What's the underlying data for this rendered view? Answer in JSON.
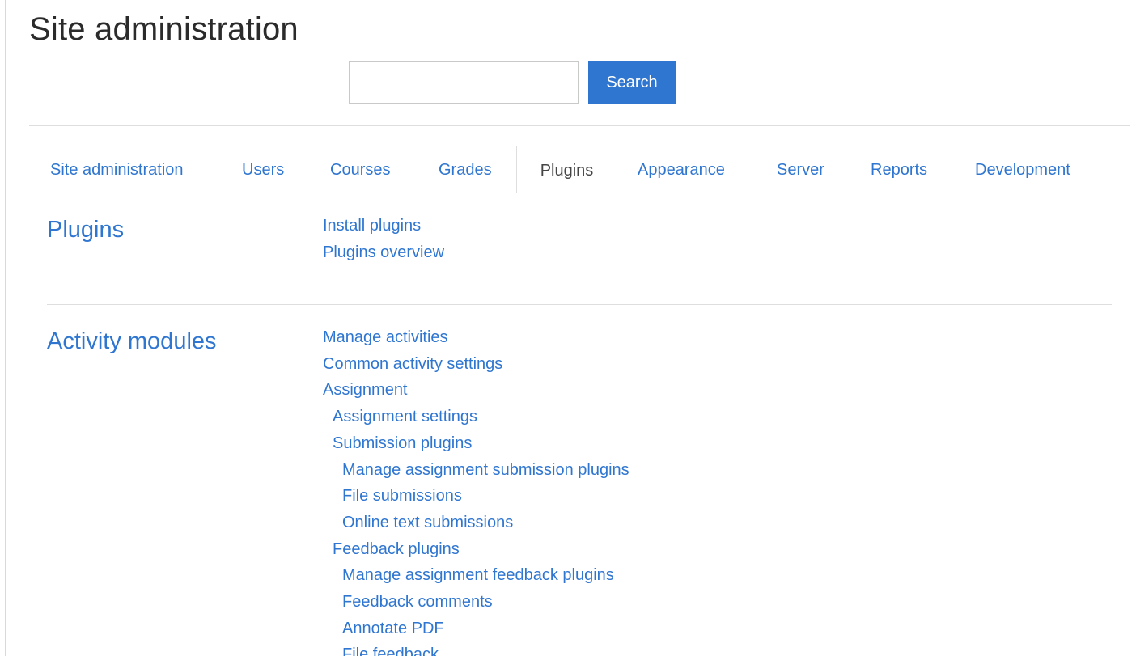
{
  "page": {
    "title": "Site administration"
  },
  "search": {
    "value": "",
    "placeholder": "",
    "button_label": "Search"
  },
  "tabs": [
    {
      "label": "Site administration",
      "active": false
    },
    {
      "label": "Users",
      "active": false
    },
    {
      "label": "Courses",
      "active": false
    },
    {
      "label": "Grades",
      "active": false
    },
    {
      "label": "Plugins",
      "active": true
    },
    {
      "label": "Appearance",
      "active": false
    },
    {
      "label": "Server",
      "active": false
    },
    {
      "label": "Reports",
      "active": false
    },
    {
      "label": "Development",
      "active": false
    }
  ],
  "sections": [
    {
      "heading": "Plugins",
      "links": [
        {
          "label": "Install plugins",
          "level": 0
        },
        {
          "label": "Plugins overview",
          "level": 0
        }
      ]
    },
    {
      "heading": "Activity modules",
      "links": [
        {
          "label": "Manage activities",
          "level": 0
        },
        {
          "label": "Common activity settings",
          "level": 0
        },
        {
          "label": "Assignment",
          "level": 0
        },
        {
          "label": "Assignment settings",
          "level": 1
        },
        {
          "label": "Submission plugins",
          "level": 1
        },
        {
          "label": "Manage assignment submission plugins",
          "level": 2
        },
        {
          "label": "File submissions",
          "level": 2
        },
        {
          "label": "Online text submissions",
          "level": 2
        },
        {
          "label": "Feedback plugins",
          "level": 1
        },
        {
          "label": "Manage assignment feedback plugins",
          "level": 2
        },
        {
          "label": "Feedback comments",
          "level": 2
        },
        {
          "label": "Annotate PDF",
          "level": 2
        },
        {
          "label": "File feedback",
          "level": 2
        }
      ]
    }
  ],
  "colors": {
    "link": "#2f76d0",
    "button": "#2f76d0",
    "title": "#2b2b2b",
    "border": "#dedede"
  }
}
